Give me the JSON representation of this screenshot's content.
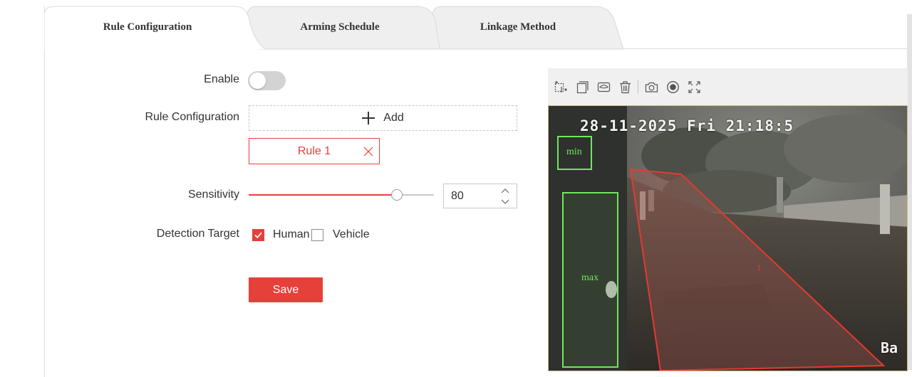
{
  "tabs": [
    {
      "label": "Rule Configuration",
      "active": true
    },
    {
      "label": "Arming Schedule",
      "active": false
    },
    {
      "label": "Linkage Method",
      "active": false
    }
  ],
  "form": {
    "enable_label": "Enable",
    "enable_on": false,
    "rule_config_label": "Rule Configuration",
    "add_label": "Add",
    "rule_name": "Rule 1",
    "sensitivity_label": "Sensitivity",
    "sensitivity_value": "80",
    "sensitivity_fraction": 0.8,
    "detection_target_label": "Detection Target",
    "targets": [
      {
        "label": "Human",
        "checked": true
      },
      {
        "label": "Vehicle",
        "checked": false
      }
    ],
    "save_label": "Save"
  },
  "toolbar": {
    "icons": [
      "draw-area-icon",
      "draw-max-size-icon",
      "draw-min-size-icon",
      "delete-icon",
      "snapshot-icon",
      "record-icon",
      "fullscreen-icon"
    ]
  },
  "video": {
    "osd_datetime": "28-11-2025 Fri 21:18:5",
    "osd_bottom": "Ba",
    "min_box_label": "min",
    "max_box_label": "max",
    "zone_label": "1"
  },
  "colors": {
    "accent": "#e5403a",
    "box_green": "#6fe85a"
  }
}
